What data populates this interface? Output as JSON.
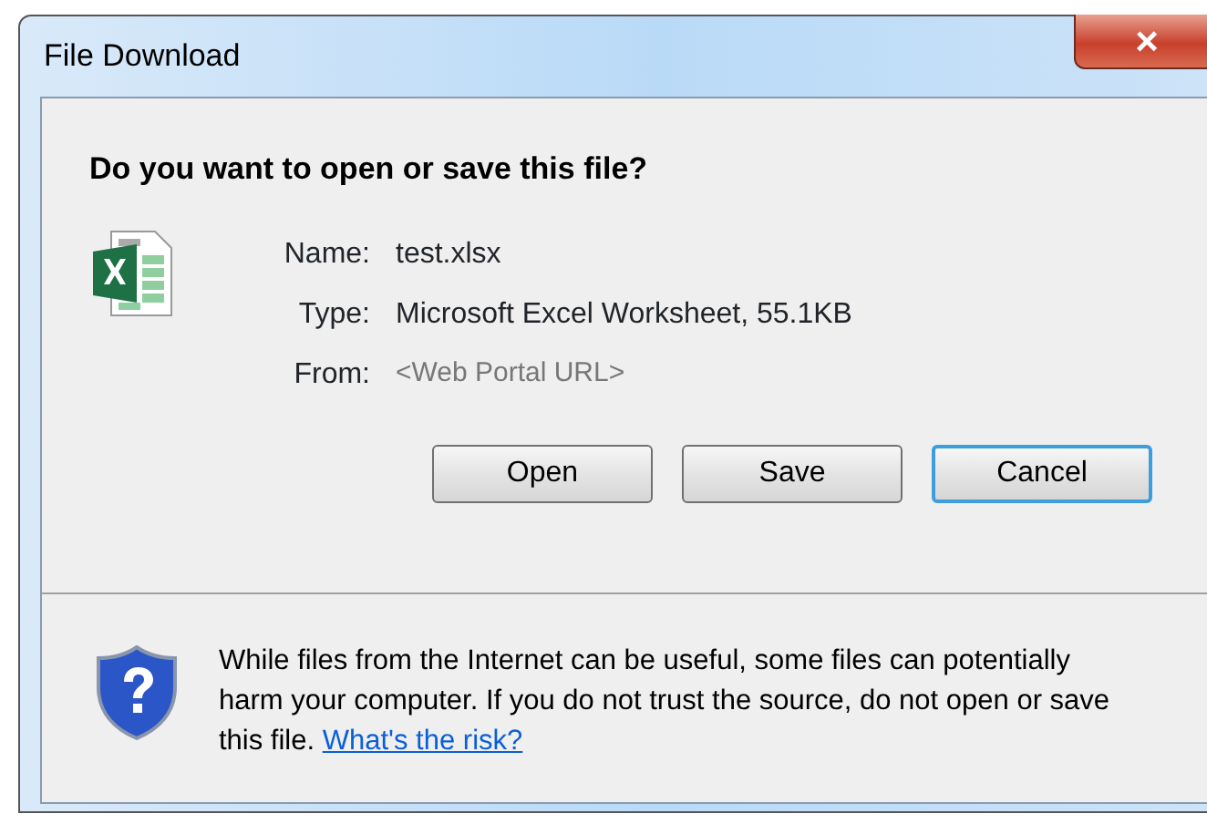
{
  "window": {
    "title": "File Download",
    "close": "×"
  },
  "heading": "Do you want to open or save this file?",
  "fields": [
    {
      "label": "Name:",
      "value": "test.xlsx",
      "muted": false
    },
    {
      "label": "Type:",
      "value": "Microsoft Excel Worksheet, 55.1KB",
      "muted": false
    },
    {
      "label": "From:",
      "value": "<Web Portal URL>",
      "muted": true
    }
  ],
  "buttons": [
    {
      "label": "Open",
      "default": false
    },
    {
      "label": "Save",
      "default": false
    },
    {
      "label": "Cancel",
      "default": true
    }
  ],
  "warning": {
    "text": "While files from the Internet can be useful, some files can potentially harm your computer. If you do not trust the source, do not open or save this file.",
    "link": "What's the risk?"
  }
}
